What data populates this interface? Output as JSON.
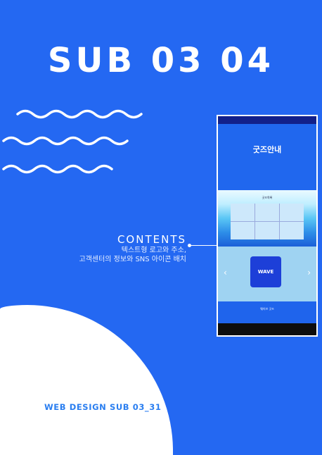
{
  "title": "SUB 03 04",
  "contents": {
    "heading": "CONTENTS",
    "desc_line1": "텍스트형 로고와 주소,",
    "desc_line2": "고객센터의 정보와 SNS 아이콘 배치"
  },
  "footer_label": "WEB DESIGN SUB 03_31",
  "mockup": {
    "hero_title": "굿즈안내",
    "list_title": "굿즈목록",
    "mug_text": "WAVE",
    "info_title": "웨이브 굿즈"
  },
  "colors": {
    "background": "#2468f2",
    "accent_text": "#2a7ef0"
  }
}
